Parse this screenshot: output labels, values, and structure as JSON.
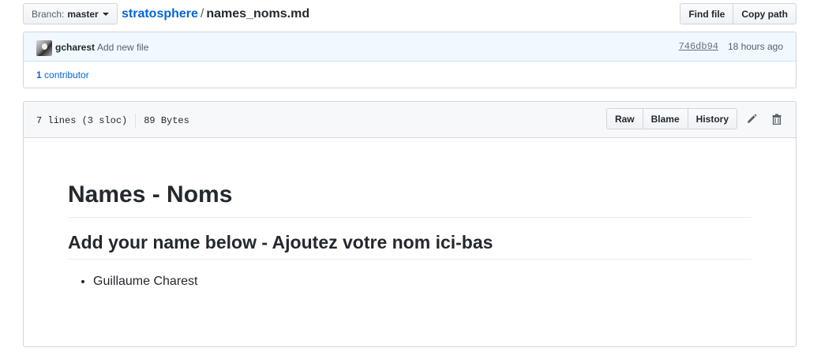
{
  "file_nav": {
    "branch_prefix": "Branch:",
    "branch_name": "master",
    "repo": "stratosphere",
    "separator": "/",
    "filename": "names_noms.md",
    "find_file": "Find file",
    "copy_path": "Copy path"
  },
  "commit": {
    "author": "gcharest",
    "message": "Add new file",
    "sha": "746db94",
    "time": "18 hours ago",
    "contributors_count": "1",
    "contributors_label": "contributor"
  },
  "file": {
    "lines": "7 lines (3 sloc)",
    "size": "89 Bytes",
    "raw": "Raw",
    "blame": "Blame",
    "history": "History",
    "edit_icon": "pencil-icon",
    "delete_icon": "trashcan-icon"
  },
  "readme": {
    "h1": "Names - Noms",
    "h2": "Add your name below - Ajoutez votre nom ici-bas",
    "items": [
      "Guillaume Charest"
    ]
  },
  "colors": {
    "link": "#0366d6",
    "tease_bg": "#f1f8ff",
    "header_bg": "#f6f8fa"
  }
}
